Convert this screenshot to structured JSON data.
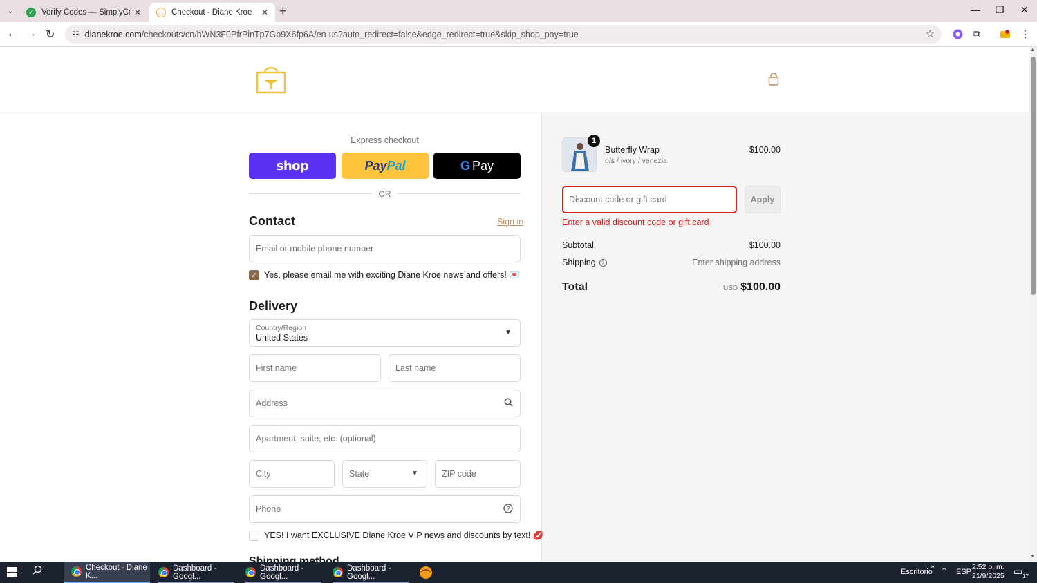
{
  "browser": {
    "tabs": [
      {
        "title": "Verify Codes — SimplyCodes",
        "active": false
      },
      {
        "title": "Checkout - Diane Kroe",
        "active": true
      }
    ],
    "url_domain": "dianekroe.com",
    "url_path": "/checkouts/cn/hWN3F0PfrPinTp7Gb9X6fp6A/en-us?auto_redirect=false&edge_redirect=true&skip_shop_pay=true"
  },
  "checkout": {
    "express_label": "Express checkout",
    "express_buttons": {
      "shop": "shop",
      "paypal_a": "Pay",
      "paypal_b": "Pal",
      "gpay_g": "G",
      "gpay_text": "Pay"
    },
    "or_text": "OR",
    "contact": {
      "title": "Contact",
      "sign_in": "Sign in",
      "email_placeholder": "Email or mobile phone number",
      "newsletter_label": "Yes, please email me with exciting Diane Kroe news and offers! 💌",
      "newsletter_checked": true
    },
    "delivery": {
      "title": "Delivery",
      "country_label": "Country/Region",
      "country_value": "United States",
      "first_name": "First name",
      "last_name": "Last name",
      "address": "Address",
      "apartment": "Apartment, suite, etc. (optional)",
      "city": "City",
      "state": "State",
      "zip": "ZIP code",
      "phone": "Phone",
      "sms_label": "YES! I want EXCLUSIVE Diane Kroe VIP news and discounts by text! 💋",
      "sms_checked": false
    },
    "next_section": "Shipping method"
  },
  "summary": {
    "product": {
      "name": "Butterfly Wrap",
      "variant": "o/s / ivory / venezia",
      "price": "$100.00",
      "quantity": "1"
    },
    "discount_placeholder": "Discount code or gift card",
    "apply_label": "Apply",
    "discount_error": "Enter a valid discount code or gift card",
    "subtotal_label": "Subtotal",
    "subtotal_value": "$100.00",
    "shipping_label": "Shipping",
    "shipping_value": "Enter shipping address",
    "total_label": "Total",
    "total_currency": "USD",
    "total_value": "$100.00"
  },
  "taskbar": {
    "apps": [
      "Checkout - Diane K...",
      "Dashboard - Googl...",
      "Dashboard - Googl...",
      "Dashboard - Googl..."
    ],
    "desktop_label": "Escritorio",
    "language": "ESP",
    "time": "2:52 p. m.",
    "date": "21/9/2025",
    "notifications": "17"
  },
  "colors": {
    "shop_pay": "#5a31f4",
    "paypal": "#ffc439",
    "error": "#dd1d1d",
    "accent_link": "#c08b5c",
    "checkbox": "#8a6a4f"
  }
}
